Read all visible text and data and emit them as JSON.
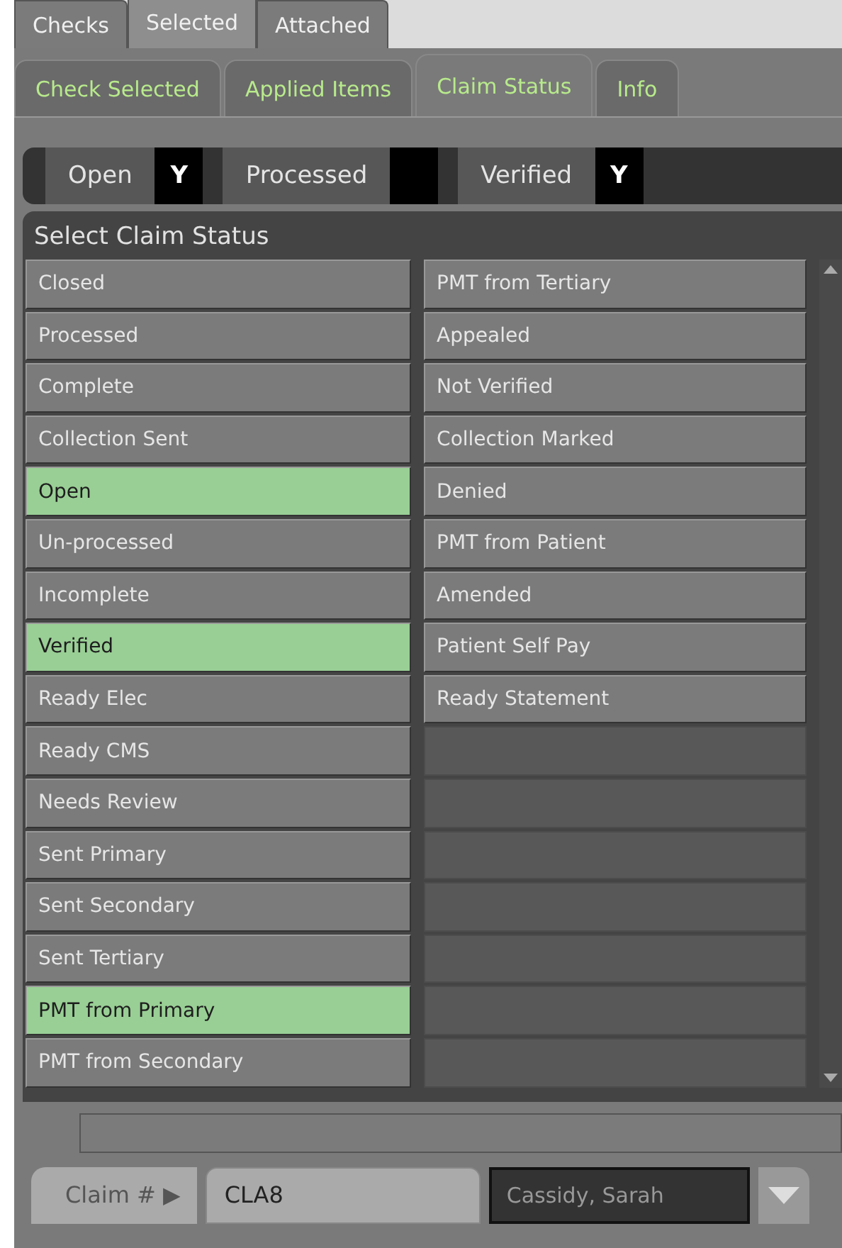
{
  "top_tabs": [
    {
      "label": "Checks",
      "selected": false
    },
    {
      "label": "Selected",
      "selected": true
    },
    {
      "label": "Attached",
      "selected": false
    }
  ],
  "sub_tabs": [
    {
      "label": "Check Selected",
      "selected": false
    },
    {
      "label": "Applied Items",
      "selected": false
    },
    {
      "label": "Claim Status",
      "selected": true
    },
    {
      "label": "Info",
      "selected": false
    }
  ],
  "status_flags": [
    {
      "label": "Open",
      "value": "Y"
    },
    {
      "label": "Processed"
    },
    {
      "label": "Verified",
      "value": "Y"
    }
  ],
  "claim_status_panel": {
    "title": "Select Claim Status",
    "columns": [
      [
        {
          "label": "Closed",
          "selected": false
        },
        {
          "label": "Processed",
          "selected": false
        },
        {
          "label": "Complete",
          "selected": false
        },
        {
          "label": "Collection Sent",
          "selected": false
        },
        {
          "label": "Open",
          "selected": true
        },
        {
          "label": "Un-processed",
          "selected": false
        },
        {
          "label": "Incomplete",
          "selected": false
        },
        {
          "label": "Verified",
          "selected": true
        },
        {
          "label": "Ready Elec",
          "selected": false
        },
        {
          "label": "Ready CMS",
          "selected": false
        },
        {
          "label": "Needs Review",
          "selected": false
        },
        {
          "label": "Sent Primary",
          "selected": false
        },
        {
          "label": "Sent Secondary",
          "selected": false
        },
        {
          "label": "Sent Tertiary",
          "selected": false
        },
        {
          "label": "PMT from Primary",
          "selected": true
        },
        {
          "label": "PMT from Secondary",
          "selected": false
        }
      ],
      [
        {
          "label": "PMT from Tertiary",
          "selected": false
        },
        {
          "label": "Appealed",
          "selected": false
        },
        {
          "label": "Not Verified",
          "selected": false
        },
        {
          "label": "Collection Marked",
          "selected": false
        },
        {
          "label": "Denied",
          "selected": false
        },
        {
          "label": "PMT from Patient",
          "selected": false
        },
        {
          "label": "Amended",
          "selected": false
        },
        {
          "label": "Patient Self Pay",
          "selected": false
        },
        {
          "label": "Ready Statement",
          "selected": false
        }
      ]
    ]
  },
  "claim": {
    "label": "Claim # ▶",
    "value": "CLA8",
    "patient": "Cassidy, Sarah"
  }
}
